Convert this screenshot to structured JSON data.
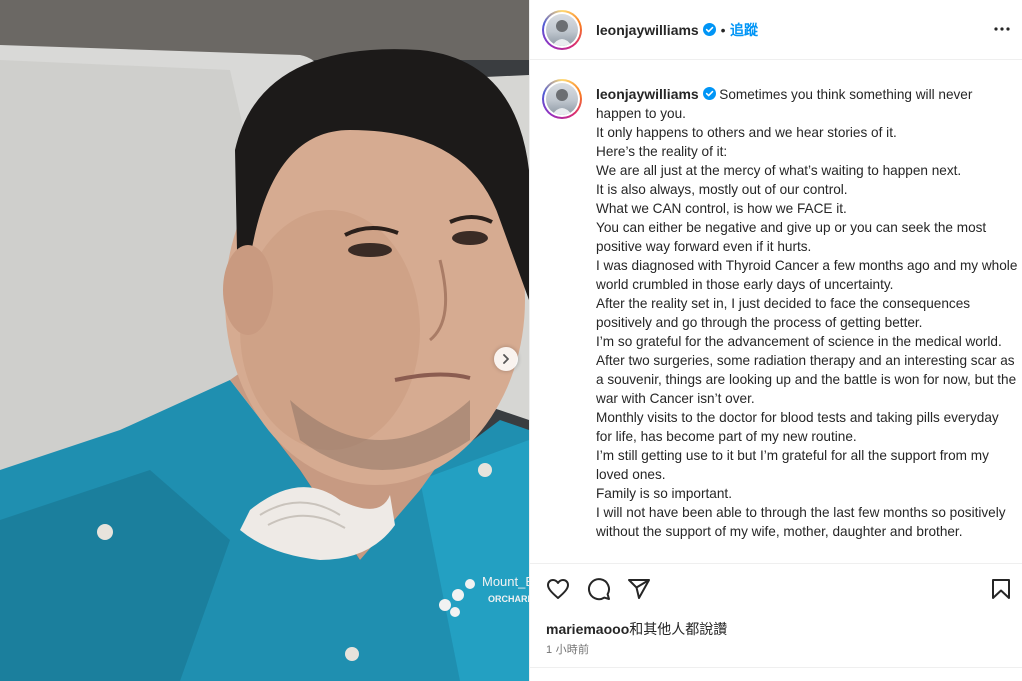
{
  "post": {
    "username": "leonjaywilliams",
    "follow_label": "追蹤",
    "separator": "•",
    "caption_lines": [
      "Sometimes you think something will never happen to you.",
      "It only happens to others and we hear stories of it.",
      "Here’s the reality of it:",
      "We are all just at the mercy of what’s waiting to happen next.",
      "It is also always, mostly out of our control.",
      "What we CAN control, is how we FACE it.",
      "You can either be negative and give up or you can seek the most positive way forward even if it hurts.",
      "I was diagnosed with Thyroid Cancer a few months ago and my whole world crumbled in those early days of uncertainty.",
      "After the reality set in, I just decided to face the consequences positively and go through the process of getting better.",
      "I’m so grateful for the advancement of science in the medical world.",
      "After two surgeries, some radiation therapy and an interesting scar as a souvenir, things are looking up and the battle is won for now, but the war with Cancer isn’t over.",
      "Monthly visits to the doctor for blood tests and taking pills everyday for life, has become part of my new routine.",
      "I’m still getting use to it but I’m grateful for all the support from my loved ones.",
      "Family is so important.",
      "I will not have been able to through the last few months so positively without the support of my wife, mother, daughter and brother."
    ],
    "liked_by_user": "mariemaooo",
    "liked_by_suffix": "和其他人都說讚",
    "timestamp": "1 小時前",
    "photo_shirt_text": "Mount_E",
    "photo_shirt_text2": "ORCHARD"
  },
  "icons": {
    "verified": "verified-badge-icon",
    "more": "more-options-icon",
    "like": "heart-icon",
    "comment": "comment-icon",
    "share": "share-icon",
    "save": "bookmark-icon",
    "next": "chevron-right-icon"
  },
  "colors": {
    "accent": "#0095f6",
    "text": "#262626",
    "muted": "#737373",
    "shirt": "#1f8fb0"
  }
}
